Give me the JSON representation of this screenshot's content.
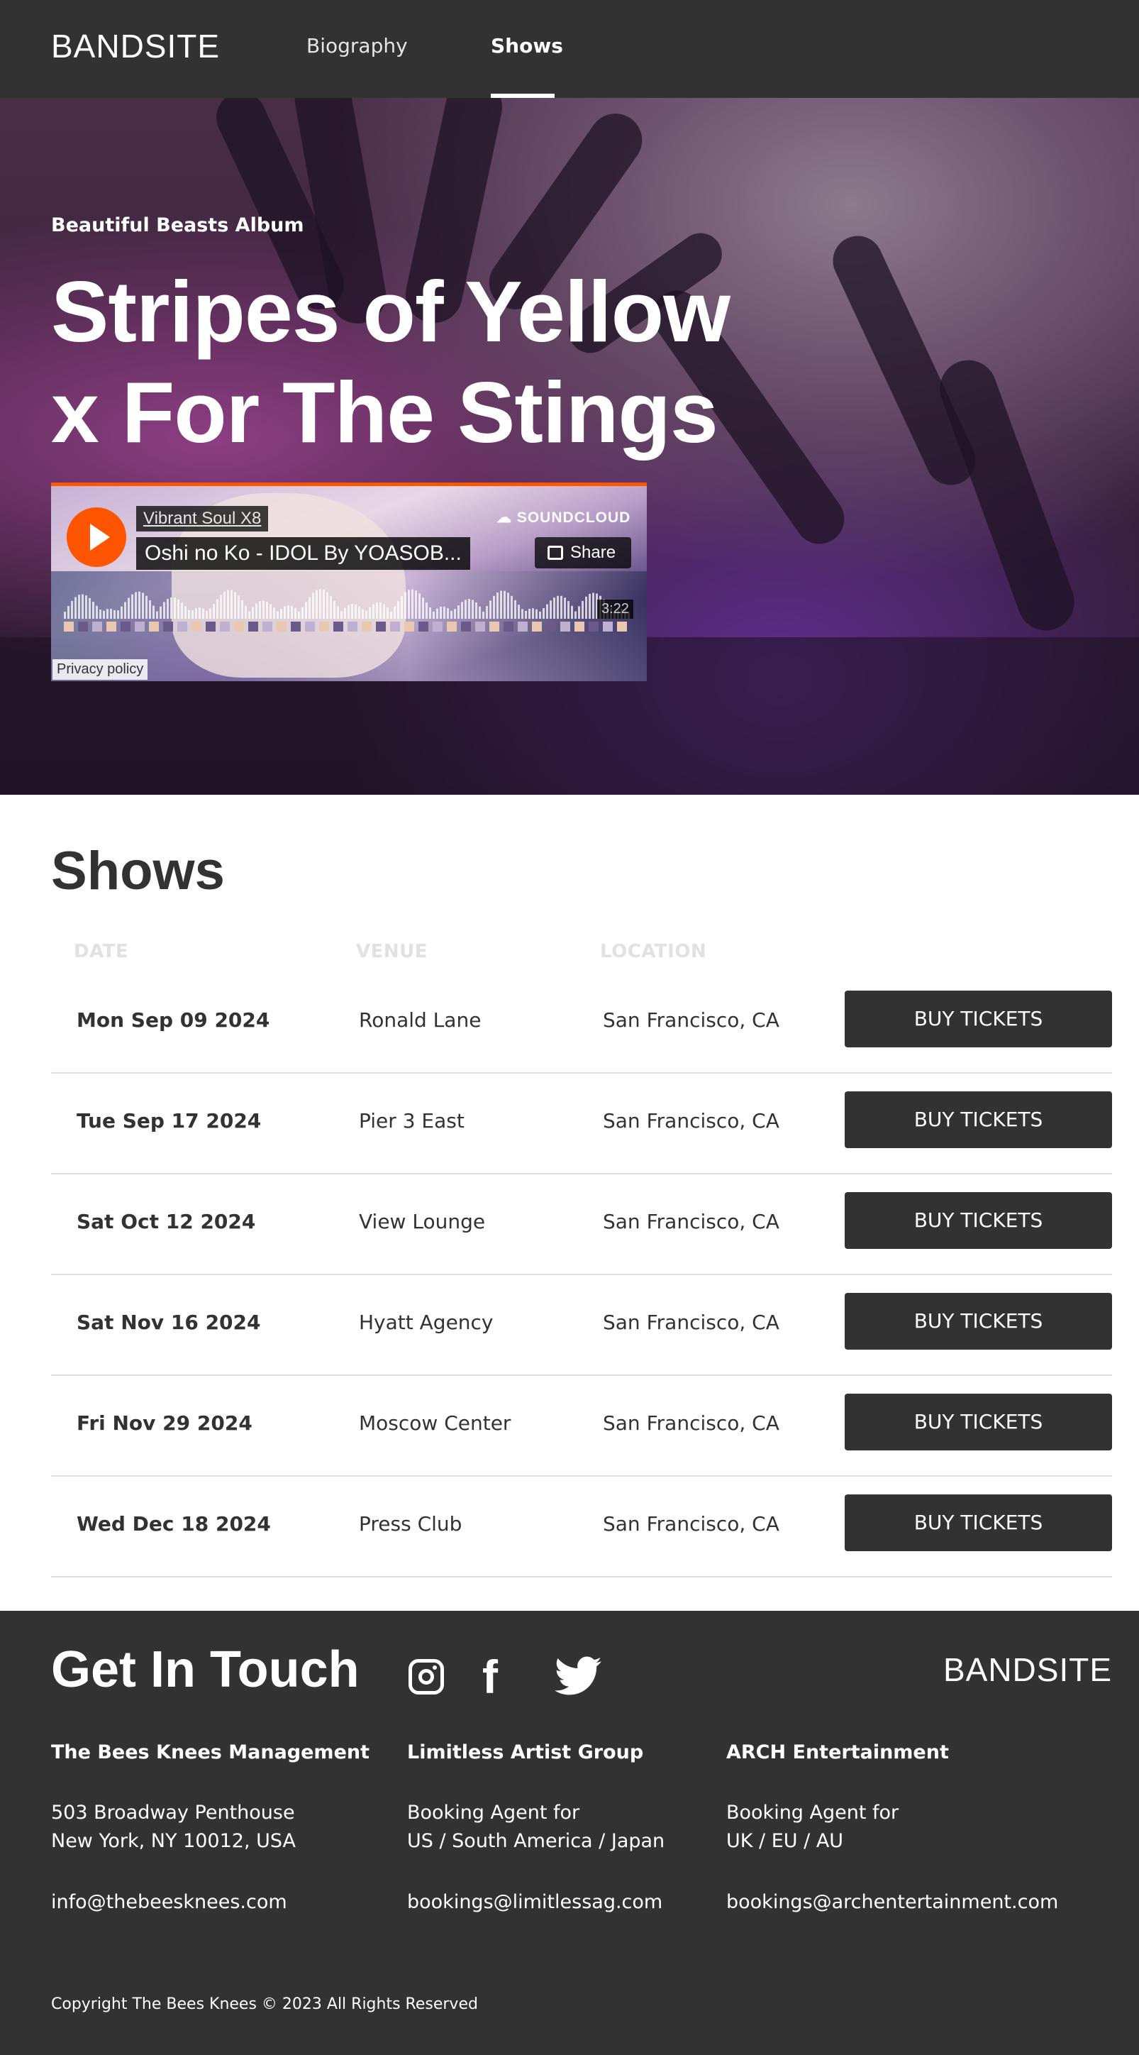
{
  "nav": {
    "logo": "BANDSITE",
    "links": [
      {
        "label": "Biography",
        "active": false
      },
      {
        "label": "Shows",
        "active": true
      }
    ]
  },
  "hero": {
    "subtitle": "Beautiful Beasts Album",
    "title_line1": "Stripes of Yellow",
    "title_line2": "x For The Stings"
  },
  "player": {
    "artist": "Vibrant Soul X8",
    "track": "Oshi no Ko - IDOL By YOASOB...",
    "brand": "SOUNDCLOUD",
    "share_label": "Share",
    "duration": "3:22",
    "privacy_label": "Privacy policy",
    "accent_color": "#ff5500"
  },
  "shows": {
    "title": "Shows",
    "headers": {
      "date": "DATE",
      "venue": "VENUE",
      "location": "LOCATION"
    },
    "button_label": "BUY TICKETS",
    "rows": [
      {
        "date": "Mon Sep 09 2024",
        "venue": "Ronald Lane",
        "location": "San Francisco, CA"
      },
      {
        "date": "Tue Sep 17 2024",
        "venue": "Pier 3 East",
        "location": "San Francisco, CA"
      },
      {
        "date": "Sat Oct 12 2024",
        "venue": "View Lounge",
        "location": "San Francisco, CA"
      },
      {
        "date": "Sat Nov 16 2024",
        "venue": "Hyatt Agency",
        "location": "San Francisco, CA"
      },
      {
        "date": "Fri Nov 29 2024",
        "venue": "Moscow Center",
        "location": "San Francisco, CA"
      },
      {
        "date": "Wed Dec 18 2024",
        "venue": "Press Club",
        "location": "San Francisco, CA"
      }
    ]
  },
  "footer": {
    "title": "Get In Touch",
    "logo": "BANDSITE",
    "social": [
      "instagram-icon",
      "facebook-icon",
      "twitter-icon"
    ],
    "columns": [
      {
        "heading": "The Bees Knees Management",
        "line1": "503 Broadway Penthouse",
        "line2": "New York, NY 10012, USA",
        "email": "info@thebeesknees.com"
      },
      {
        "heading": "Limitless Artist Group",
        "line1": "Booking Agent for",
        "line2": "US / South America / Japan",
        "email": "bookings@limitlessag.com"
      },
      {
        "heading": "ARCH Entertainment",
        "line1": "Booking Agent for",
        "line2": "UK / EU / AU",
        "email": "bookings@archentertainment.com"
      }
    ],
    "copyright": "Copyright The Bees Knees © 2023 All Rights Reserved"
  },
  "colors": {
    "primary_dark": "#323232",
    "divider": "#e1e1e1",
    "header_muted": "#e1e1e1"
  }
}
